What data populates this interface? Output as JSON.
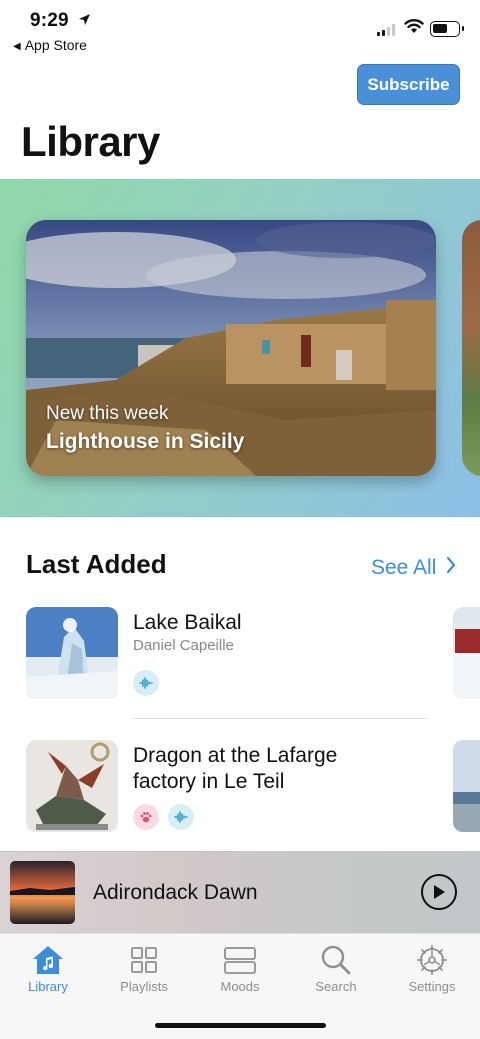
{
  "status_bar": {
    "time": "9:29",
    "back_app": "App Store"
  },
  "header": {
    "subscribe_label": "Subscribe",
    "title": "Library"
  },
  "featured": {
    "kicker": "New this week",
    "title": "Lighthouse in Sicily"
  },
  "last_added": {
    "title": "Last Added",
    "see_all_label": "See All",
    "items": [
      {
        "title": "Lake Baikal",
        "author": "Daniel Capeille",
        "tags": [
          "ambient-icon"
        ]
      },
      {
        "title_line1": "Dragon at the Lafarge",
        "title_line2": "factory in Le Teil",
        "tags": [
          "paw-icon",
          "ambient-icon"
        ]
      }
    ]
  },
  "now_playing": {
    "title": "Adirondack Dawn",
    "state": "paused"
  },
  "tab_bar": {
    "tabs": [
      {
        "label": "Library",
        "icon": "library-home-icon",
        "active": true
      },
      {
        "label": "Playlists",
        "icon": "grid-icon",
        "active": false
      },
      {
        "label": "Moods",
        "icon": "moods-icon",
        "active": false
      },
      {
        "label": "Search",
        "icon": "search-icon",
        "active": false
      },
      {
        "label": "Settings",
        "icon": "gear-icon",
        "active": false
      }
    ]
  },
  "colors": {
    "accent": "#3d8ed6",
    "subscribe_bg": "#4a90d9",
    "inactive_tab": "#8e8e93"
  }
}
